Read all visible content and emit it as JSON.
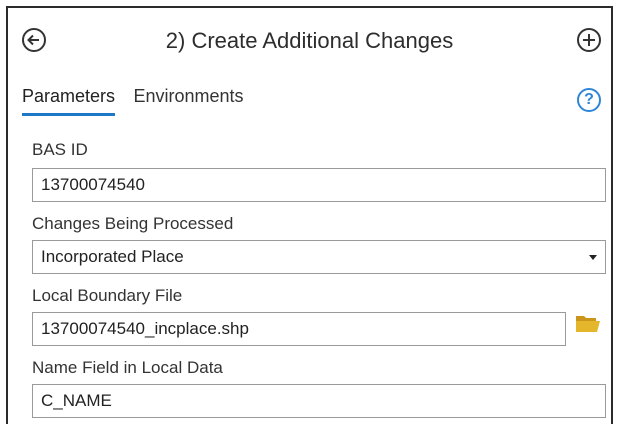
{
  "header": {
    "title": "2) Create Additional Changes"
  },
  "tabs": [
    {
      "label": "Parameters",
      "active": true
    },
    {
      "label": "Environments",
      "active": false
    }
  ],
  "fields": {
    "bas_id": {
      "label": "BAS ID",
      "value": "13700074540"
    },
    "changes": {
      "label": "Changes Being Processed",
      "value": "Incorporated Place"
    },
    "boundary_file": {
      "label": "Local Boundary File",
      "value": "13700074540_incplace.shp"
    },
    "name_field": {
      "label": "Name Field in Local Data",
      "value": "C_NAME"
    }
  },
  "icons": {
    "back": "back-arrow-icon",
    "add": "plus-icon",
    "help": "help-icon",
    "folder": "folder-icon"
  },
  "colors": {
    "accent": "#1f77c8",
    "help": "#2f86d6",
    "folder": "#e3b62b"
  }
}
